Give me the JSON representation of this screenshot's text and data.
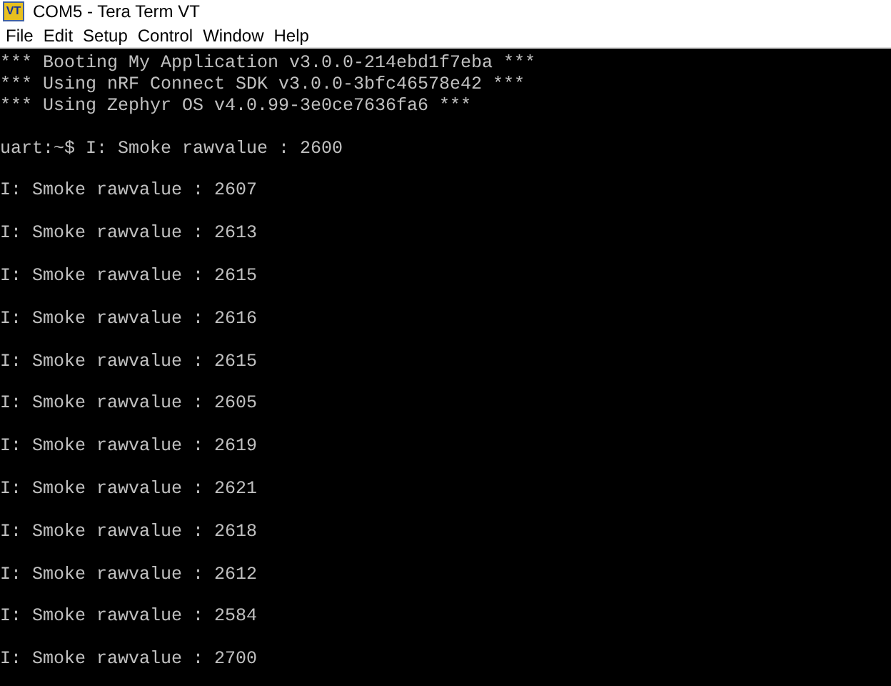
{
  "window": {
    "icon_label": "VT",
    "title": "COM5 - Tera Term VT"
  },
  "menu": [
    "File",
    "Edit",
    "Setup",
    "Control",
    "Window",
    "Help"
  ],
  "terminal": {
    "banner": [
      "*** Booting My Application v3.0.0-214ebd1f7eba ***",
      "*** Using nRF Connect SDK v3.0.0-3bfc46578e42 ***",
      "*** Using Zephyr OS v4.0.99-3e0ce7636fa6 ***"
    ],
    "lines": [
      "uart:~$ I: Smoke rawvalue : 2600",
      "I: Smoke rawvalue : 2607",
      "I: Smoke rawvalue : 2613",
      "I: Smoke rawvalue : 2615",
      "I: Smoke rawvalue : 2616",
      "I: Smoke rawvalue : 2615",
      "I: Smoke rawvalue : 2605",
      "I: Smoke rawvalue : 2619",
      "I: Smoke rawvalue : 2621",
      "I: Smoke rawvalue : 2618",
      "I: Smoke rawvalue : 2612",
      "I: Smoke rawvalue : 2584",
      "I: Smoke rawvalue : 2700"
    ]
  }
}
